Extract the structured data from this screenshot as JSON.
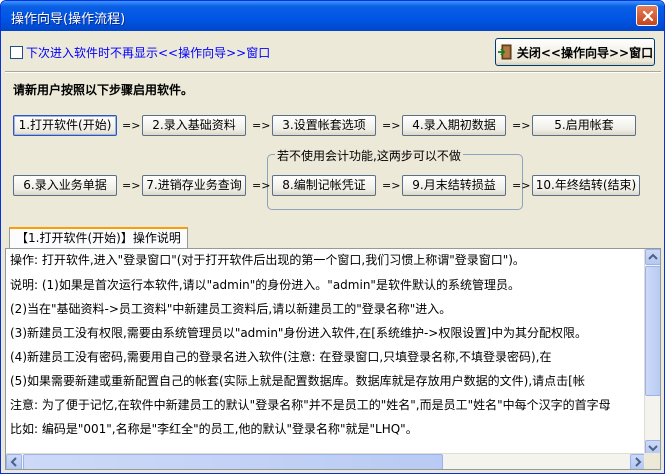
{
  "window": {
    "title": "操作向导(操作流程)"
  },
  "topbar": {
    "checkbox_label": "下次进入软件时不再显示<<操作向导>>窗口",
    "close_wizard_label": "关闭<<操作向导>>窗口"
  },
  "flow": {
    "intro": "请新用户按照以下步骤启用软件。",
    "arrow": "=>",
    "group_title": "若不使用会计功能,这两步可以不做",
    "steps": [
      {
        "label": "1.打开软件(开始)"
      },
      {
        "label": "2.录入基础资料"
      },
      {
        "label": "3.设置帐套选项"
      },
      {
        "label": "4.录入期初数据"
      },
      {
        "label": "5.启用帐套"
      },
      {
        "label": "6.录入业务单据"
      },
      {
        "label": "7.进销存业务查询"
      },
      {
        "label": "8.编制记帐凭证"
      },
      {
        "label": "9.月末结转损益"
      },
      {
        "label": "10.年终结转(结束)"
      }
    ]
  },
  "tab": {
    "label": "【1.打开软件(开始)】操作说明"
  },
  "description": {
    "lines": [
      "操作: 打开软件,进入\"登录窗口\"(对于打开软件后出现的第一个窗口,我们习惯上称谓\"登录窗口\")。",
      "说明: (1)如果是首次运行本软件,请以\"admin\"的身份进入。\"admin\"是软件默认的系统管理员。",
      "      (2)当在\"基础资料->员工资料\"中新建员工资料后,请以新建员工的\"登录名称\"进入。",
      "      (3)新建员工没有权限,需要由系统管理员以\"admin\"身份进入软件,在[系统维护->权限设置]中为其分配权限。",
      "      (4)新建员工没有密码,需要用自己的登录名进入软件(注意: 在登录窗口,只填登录名称,不填登录密码),在",
      "      (5)如果需要新建或重新配置自己的帐套(实际上就是配置数据库。数据库就是存放用户数据的文件),请点击[帐",
      "注意: 为了便于记忆,在软件中新建员工的默认\"登录名称\"并不是员工的\"姓名\",而是员工\"姓名\"中每个汉字的首字母",
      "      比如: 编码是\"001\",名称是\"李红全\"的员工,他的默认\"登录名称\"就是\"LHQ\"。"
    ]
  }
}
